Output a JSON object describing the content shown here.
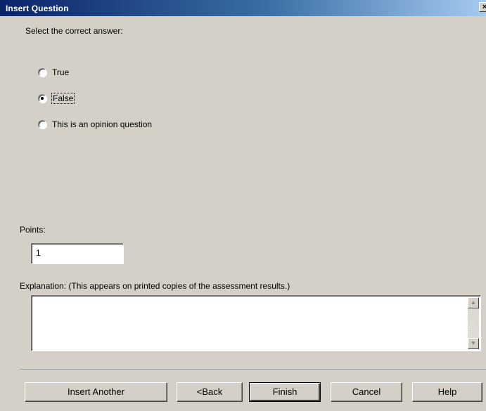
{
  "window": {
    "title": "Insert Question",
    "close_glyph": "×"
  },
  "question": {
    "prompt": "Select the correct answer:",
    "options": [
      {
        "label": "True",
        "checked": false
      },
      {
        "label": "False",
        "checked": true
      },
      {
        "label": "This is an opinion question",
        "checked": false
      }
    ]
  },
  "points": {
    "label": "Points:",
    "value": "1"
  },
  "explanation": {
    "label": "Explanation: (This appears on printed copies of the assessment results.)",
    "value": ""
  },
  "buttons": {
    "insert_another": "Insert Another",
    "back": "<Back",
    "finish": "Finish",
    "cancel": "Cancel",
    "help": "Help"
  },
  "icons": {
    "scroll_up": "scroll-up-arrow-icon",
    "scroll_down": "scroll-down-arrow-icon"
  },
  "colors": {
    "titlebar_start": "#0a246a",
    "titlebar_end": "#a6caf0",
    "dialog_face": "#d4d0c8"
  }
}
